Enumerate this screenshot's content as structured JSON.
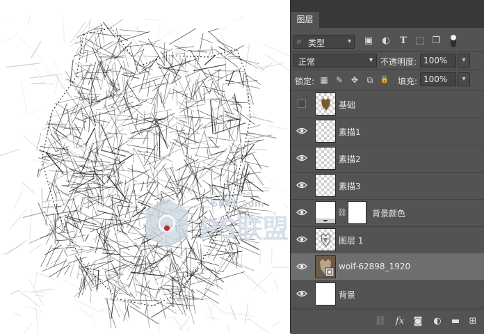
{
  "panel": {
    "tab_label": "图层",
    "filter": {
      "search_glyph": "⌕",
      "label": "类型",
      "dropdown": "▾"
    },
    "filter_icons": [
      "image-filter-icon",
      "adjustment-filter-icon",
      "type-filter-icon",
      "shape-filter-icon",
      "smart-object-filter-icon"
    ],
    "filter_glyphs": {
      "image": "▣",
      "adjust": "◐",
      "type": "T",
      "shape": "⬚",
      "smart": "❐"
    },
    "blend_mode": "正常",
    "opacity_label": "不透明度:",
    "opacity_value": "100%",
    "lock_label": "锁定:",
    "lock_glyphs": {
      "pixels": "▦",
      "paint": "✎",
      "move": "✥",
      "artboard": "⧉",
      "all": "🔒"
    },
    "fill_label": "填充:",
    "fill_value": "100%",
    "dd": "▾"
  },
  "layers": [
    {
      "name": "基础",
      "visible": false,
      "thumb": "wolf-shape"
    },
    {
      "name": "素描1",
      "visible": true,
      "thumb": "transparent"
    },
    {
      "name": "素描2",
      "visible": true,
      "thumb": "transparent"
    },
    {
      "name": "素描3",
      "visible": true,
      "thumb": "transparent"
    },
    {
      "name": "背景颜色",
      "visible": true,
      "thumb": "fill-with-mask"
    },
    {
      "name": "图层 1",
      "visible": true,
      "thumb": "wolf-outline"
    },
    {
      "name": "wolf-62898_1920",
      "visible": true,
      "thumb": "photo",
      "selected": true
    },
    {
      "name": "背景",
      "visible": true,
      "thumb": "white"
    }
  ],
  "bottom_bar": {
    "link": "⛓",
    "fx": "fx",
    "mask": "◙",
    "adjust": "◐",
    "group": "▬",
    "new": "⊞"
  },
  "watermark": {
    "site": "68PS.com",
    "brand": "PS联盟"
  },
  "colors": {
    "panel_bg": "#535353",
    "tab_bar": "#383838",
    "selected_row": "#6e6e6e"
  }
}
